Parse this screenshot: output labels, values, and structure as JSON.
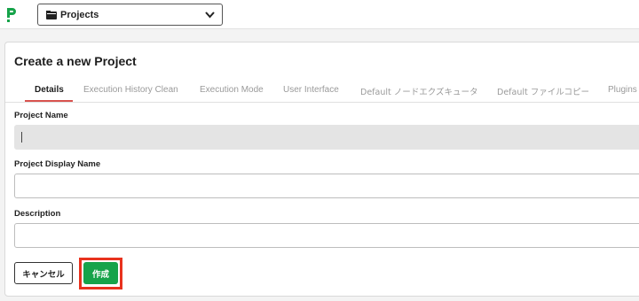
{
  "topbar": {
    "project_select": {
      "label": "Projects"
    }
  },
  "form": {
    "title": "Create a new Project",
    "tabs": [
      {
        "label": "Details",
        "active": true
      },
      {
        "label": "Execution History Clean",
        "active": false
      },
      {
        "label": "Execution Mode",
        "active": false
      },
      {
        "label": "User Interface",
        "active": false
      },
      {
        "label": "Default ノードエクズキュータ",
        "active": false
      },
      {
        "label": "Default ファイルコピー",
        "active": false
      },
      {
        "label": "Plugins",
        "active": false
      }
    ],
    "fields": {
      "project_name": {
        "label": "Project Name",
        "value": ""
      },
      "display_name": {
        "label": "Project Display Name",
        "value": ""
      },
      "description": {
        "label": "Description",
        "value": ""
      }
    },
    "buttons": {
      "cancel": "キャンセル",
      "create": "作成"
    }
  },
  "colors": {
    "brand_green": "#16a34a",
    "active_tab_underline": "#d9534f",
    "highlight_outline": "#e8321e"
  }
}
